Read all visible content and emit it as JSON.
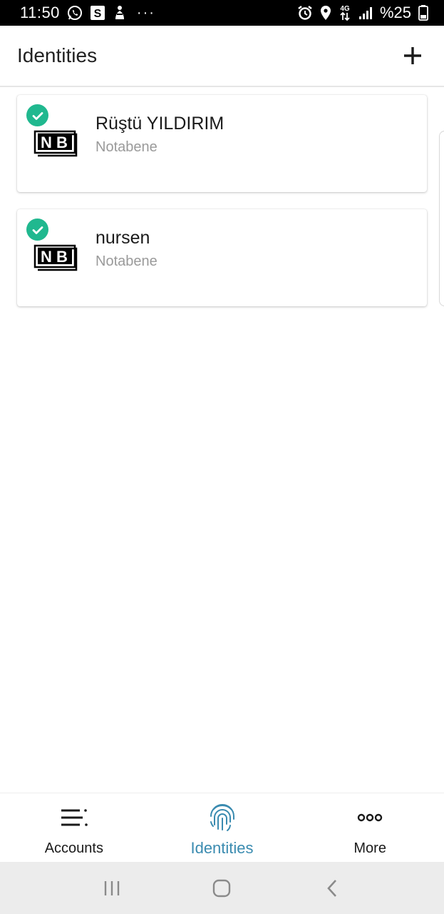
{
  "status_bar": {
    "time": "11:50",
    "battery": "%25",
    "network": "4G",
    "overflow": "···",
    "left_icons": [
      "whatsapp-icon",
      "s-app-icon",
      "hand-icon"
    ],
    "right_icons": [
      "alarm-icon",
      "location-icon",
      "data-arrows-icon",
      "signal-icon",
      "battery-icon"
    ]
  },
  "app_bar": {
    "title": "Identities",
    "add_icon": "plus-icon"
  },
  "identities": [
    {
      "name": "Rüştü YILDIRIM",
      "provider": "Notabene",
      "logo": "NB",
      "status": "verified"
    },
    {
      "name": "nursen",
      "provider": "Notabene",
      "logo": "NB",
      "status": "verified"
    }
  ],
  "bottom_nav": {
    "items": [
      {
        "label": "Accounts",
        "icon": "accounts-list-icon",
        "active": false
      },
      {
        "label": "Identities",
        "icon": "fingerprint-icon",
        "active": true
      },
      {
        "label": "More",
        "icon": "more-dots-icon",
        "active": false
      }
    ]
  },
  "colors": {
    "accent": "#3a8bb0",
    "check_green": "#20b88f",
    "status_bar_bg": "#000000",
    "system_nav_bg": "#ececec"
  }
}
